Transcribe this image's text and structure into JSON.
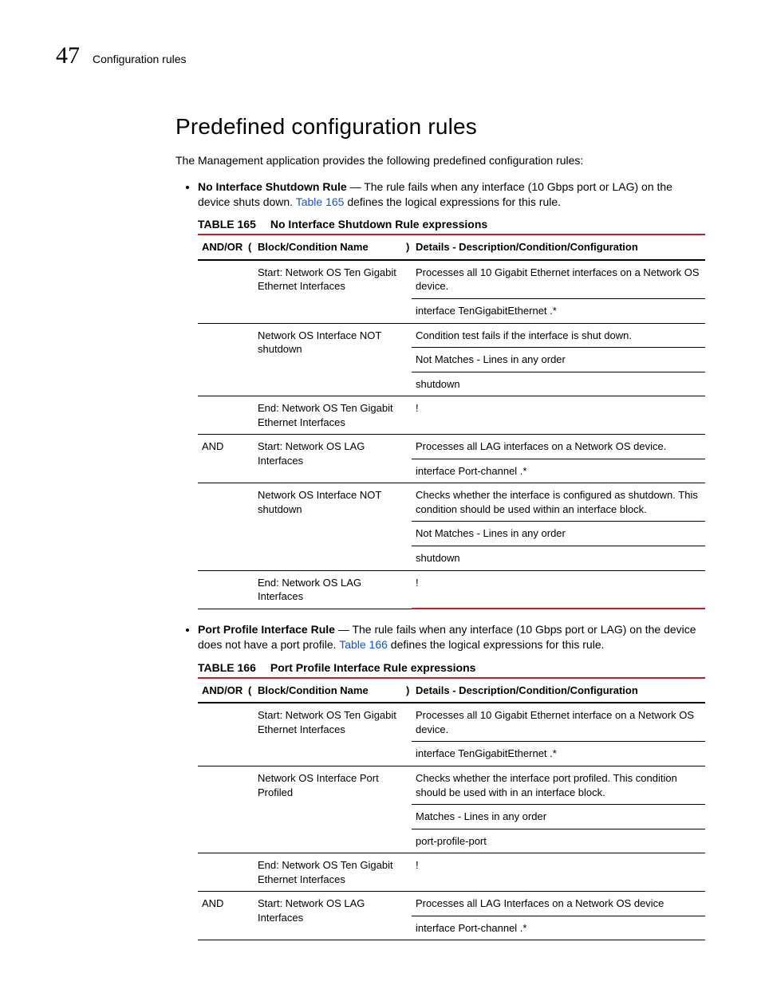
{
  "header": {
    "chapter_number": "47",
    "breadcrumb": "Configuration rules"
  },
  "section_title": "Predefined configuration rules",
  "intro": "The Management application provides the following predefined configuration rules:",
  "rule1": {
    "name": "No Interface Shutdown Rule",
    "desc_a": " — The rule fails when any interface (10 Gbps port or LAG) on the device shuts down. ",
    "link": "Table 165",
    "desc_b": " defines the logical expressions for this rule."
  },
  "rule2": {
    "name": "Port Profile Interface Rule",
    "desc_a": " — The rule fails when any interface (10 Gbps port or LAG) on the device does not have a port profile. ",
    "link": "Table 166",
    "desc_b": " defines the logical expressions for this rule."
  },
  "table1": {
    "number": "TABLE 165",
    "title": "No Interface Shutdown Rule expressions",
    "head": {
      "andor": "AND/OR",
      "p1": "(",
      "block": "Block/Condition Name",
      "p2": ")",
      "details": "Details - Description/Condition/Configuration"
    },
    "rows": [
      {
        "andor": "",
        "block": "Start: Network OS Ten Gigabit Ethernet Interfaces",
        "det": "Processes all 10 Gigabit Ethernet interfaces on a Network OS device.",
        "rs_block": 2
      },
      {
        "det": "interface TenGigabitEthernet .*"
      },
      {
        "andor": "",
        "block": "Network OS Interface NOT shutdown",
        "det": "Condition test fails if the interface is shut down.",
        "rs_block": 3
      },
      {
        "det": "Not Matches - Lines in any order"
      },
      {
        "det": "shutdown"
      },
      {
        "andor": "",
        "block": "End: Network OS Ten Gigabit Ethernet Interfaces",
        "det": "!",
        "rs_block": 1
      },
      {
        "andor": "AND",
        "block": "Start: Network OS LAG Interfaces",
        "det": "Processes all LAG interfaces on a Network OS device.",
        "rs_block": 2
      },
      {
        "det": "interface Port-channel .*"
      },
      {
        "andor": "",
        "block": "Network OS Interface NOT shutdown",
        "det": "Checks whether the interface is configured as shutdown. This condition should be used within an interface block.",
        "rs_block": 3
      },
      {
        "det": "Not Matches - Lines in any order"
      },
      {
        "det": "shutdown"
      },
      {
        "andor": "",
        "block": "End: Network OS LAG Interfaces",
        "det": "!",
        "rs_block": 1,
        "last": true
      }
    ]
  },
  "table2": {
    "number": "TABLE 166",
    "title": "Port Profile Interface Rule expressions",
    "head": {
      "andor": "AND/OR",
      "p1": "(",
      "block": "Block/Condition Name",
      "p2": ")",
      "details": "Details - Description/Condition/Configuration"
    },
    "rows": [
      {
        "andor": "",
        "block": "Start: Network OS Ten Gigabit Ethernet Interfaces",
        "det": "Processes all 10 Gigabit Ethernet interface on a Network OS device.",
        "rs_block": 2
      },
      {
        "det": "interface TenGigabitEthernet .*"
      },
      {
        "andor": "",
        "block": "Network OS Interface Port Profiled",
        "det": "Checks whether the interface port profiled. This condition should be used with in an interface block.",
        "rs_block": 3
      },
      {
        "det": "Matches - Lines in any order"
      },
      {
        "det": "port-profile-port"
      },
      {
        "andor": "",
        "block": "End: Network OS Ten Gigabit Ethernet Interfaces",
        "det": "!",
        "rs_block": 1
      },
      {
        "andor": "AND",
        "block": "Start: Network OS LAG Interfaces",
        "det": "Processes all LAG Interfaces on a Network OS device",
        "rs_block": 2
      },
      {
        "det": "interface Port-channel .*"
      }
    ]
  }
}
